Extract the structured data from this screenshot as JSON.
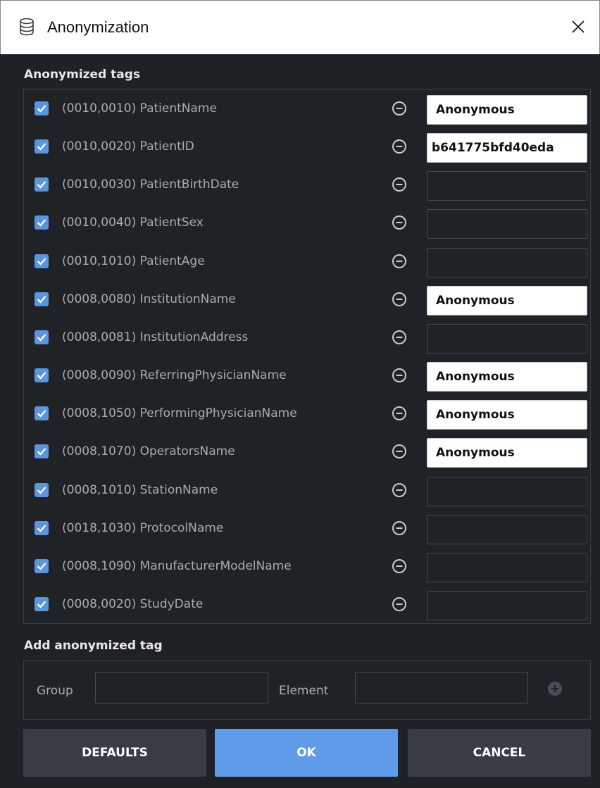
{
  "window": {
    "title": "Anonymization",
    "icon": "database-icon",
    "close_icon": "close-icon"
  },
  "sections": {
    "anonymized_tags": "Anonymized tags",
    "add_tag": "Add anonymized tag"
  },
  "tags": [
    {
      "label": "(0010,0010) PatientName",
      "checked": true,
      "value": "Anonymous"
    },
    {
      "label": "(0010,0020) PatientID",
      "checked": true,
      "value": "b641775bfd40eda"
    },
    {
      "label": "(0010,0030) PatientBirthDate",
      "checked": true,
      "value": ""
    },
    {
      "label": "(0010,0040) PatientSex",
      "checked": true,
      "value": ""
    },
    {
      "label": "(0010,1010) PatientAge",
      "checked": true,
      "value": ""
    },
    {
      "label": "(0008,0080) InstitutionName",
      "checked": true,
      "value": "Anonymous"
    },
    {
      "label": "(0008,0081) InstitutionAddress",
      "checked": true,
      "value": ""
    },
    {
      "label": "(0008,0090) ReferringPhysicianName",
      "checked": true,
      "value": "Anonymous"
    },
    {
      "label": "(0008,1050) PerformingPhysicianName",
      "checked": true,
      "value": "Anonymous"
    },
    {
      "label": "(0008,1070) OperatorsName",
      "checked": true,
      "value": "Anonymous"
    },
    {
      "label": "(0008,1010) StationName",
      "checked": true,
      "value": ""
    },
    {
      "label": "(0018,1030) ProtocolName",
      "checked": true,
      "value": ""
    },
    {
      "label": "(0008,1090) ManufacturerModelName",
      "checked": true,
      "value": ""
    },
    {
      "label": "(0008,0020) StudyDate",
      "checked": true,
      "value": ""
    }
  ],
  "add_form": {
    "group_label": "Group",
    "group_value": "",
    "element_label": "Element",
    "element_value": "",
    "add_icon": "plus-circle-icon"
  },
  "buttons": {
    "defaults": "DEFAULTS",
    "ok": "OK",
    "cancel": "CANCEL"
  },
  "colors": {
    "background": "#1e2125",
    "checkbox": "#5b96dd",
    "primary_button": "#5f9be6",
    "secondary_button": "#393d43",
    "label_text": "#a9acb1"
  }
}
